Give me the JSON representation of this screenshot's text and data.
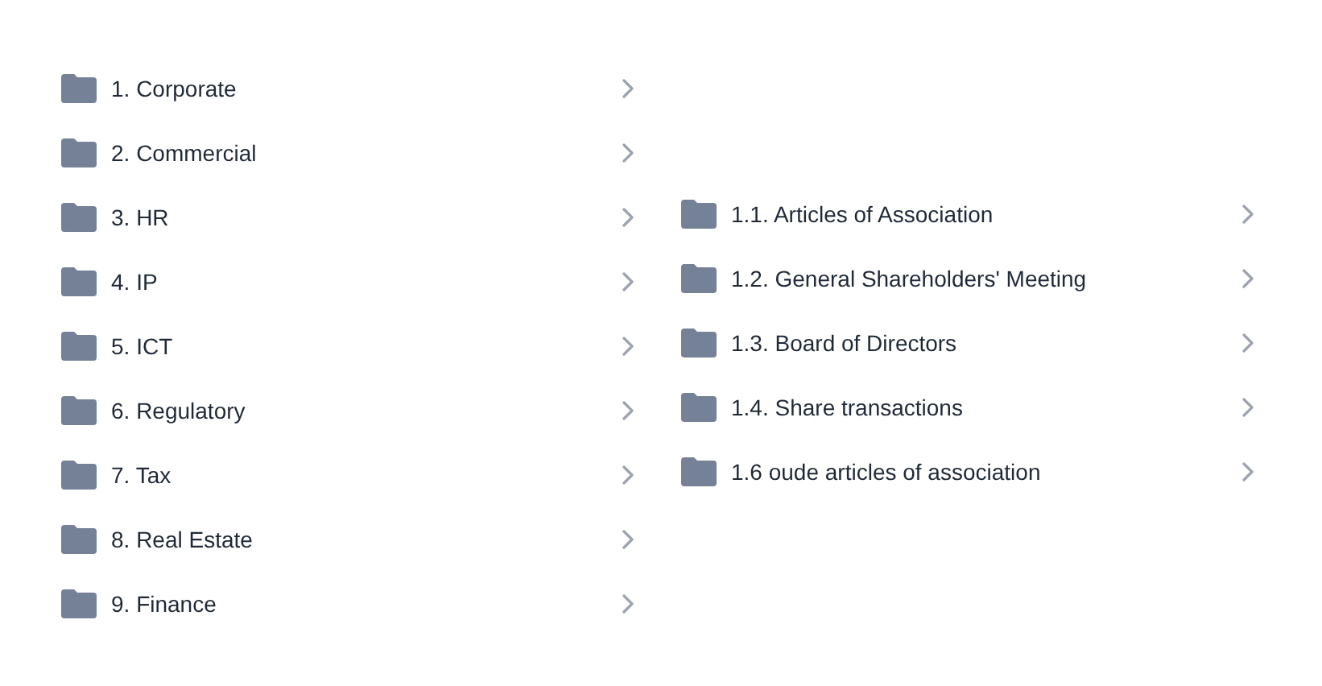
{
  "folders": [
    {
      "name": "1. Corporate"
    },
    {
      "name": "2. Commercial"
    },
    {
      "name": "3. HR"
    },
    {
      "name": "4. IP"
    },
    {
      "name": "5. ICT"
    },
    {
      "name": "6. Regulatory"
    },
    {
      "name": "7. Tax"
    },
    {
      "name": "8. Real Estate"
    },
    {
      "name": "9. Finance"
    }
  ],
  "subfolders": [
    {
      "name": "1.1. Articles of Association"
    },
    {
      "name": "1.2. General Shareholders' Meeting"
    },
    {
      "name": "1.3. Board of Directors"
    },
    {
      "name": "1.4. Share transactions"
    },
    {
      "name": "1.6 oude articles of association"
    }
  ]
}
